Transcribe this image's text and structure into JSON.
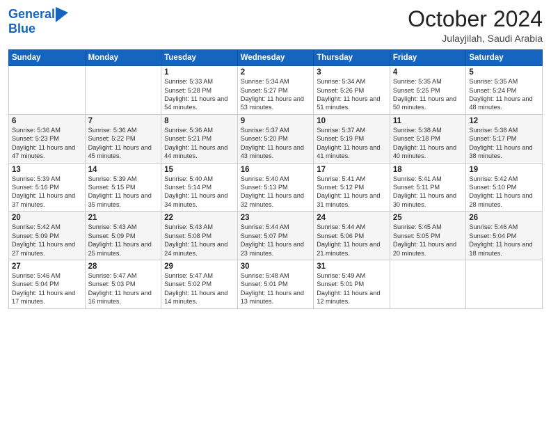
{
  "header": {
    "logo_line1": "General",
    "logo_line2": "Blue",
    "month": "October 2024",
    "location": "Julayjilah, Saudi Arabia"
  },
  "weekdays": [
    "Sunday",
    "Monday",
    "Tuesday",
    "Wednesday",
    "Thursday",
    "Friday",
    "Saturday"
  ],
  "weeks": [
    [
      {
        "day": "",
        "info": ""
      },
      {
        "day": "",
        "info": ""
      },
      {
        "day": "1",
        "info": "Sunrise: 5:33 AM\nSunset: 5:28 PM\nDaylight: 11 hours and 54 minutes."
      },
      {
        "day": "2",
        "info": "Sunrise: 5:34 AM\nSunset: 5:27 PM\nDaylight: 11 hours and 53 minutes."
      },
      {
        "day": "3",
        "info": "Sunrise: 5:34 AM\nSunset: 5:26 PM\nDaylight: 11 hours and 51 minutes."
      },
      {
        "day": "4",
        "info": "Sunrise: 5:35 AM\nSunset: 5:25 PM\nDaylight: 11 hours and 50 minutes."
      },
      {
        "day": "5",
        "info": "Sunrise: 5:35 AM\nSunset: 5:24 PM\nDaylight: 11 hours and 48 minutes."
      }
    ],
    [
      {
        "day": "6",
        "info": "Sunrise: 5:36 AM\nSunset: 5:23 PM\nDaylight: 11 hours and 47 minutes."
      },
      {
        "day": "7",
        "info": "Sunrise: 5:36 AM\nSunset: 5:22 PM\nDaylight: 11 hours and 45 minutes."
      },
      {
        "day": "8",
        "info": "Sunrise: 5:36 AM\nSunset: 5:21 PM\nDaylight: 11 hours and 44 minutes."
      },
      {
        "day": "9",
        "info": "Sunrise: 5:37 AM\nSunset: 5:20 PM\nDaylight: 11 hours and 43 minutes."
      },
      {
        "day": "10",
        "info": "Sunrise: 5:37 AM\nSunset: 5:19 PM\nDaylight: 11 hours and 41 minutes."
      },
      {
        "day": "11",
        "info": "Sunrise: 5:38 AM\nSunset: 5:18 PM\nDaylight: 11 hours and 40 minutes."
      },
      {
        "day": "12",
        "info": "Sunrise: 5:38 AM\nSunset: 5:17 PM\nDaylight: 11 hours and 38 minutes."
      }
    ],
    [
      {
        "day": "13",
        "info": "Sunrise: 5:39 AM\nSunset: 5:16 PM\nDaylight: 11 hours and 37 minutes."
      },
      {
        "day": "14",
        "info": "Sunrise: 5:39 AM\nSunset: 5:15 PM\nDaylight: 11 hours and 35 minutes."
      },
      {
        "day": "15",
        "info": "Sunrise: 5:40 AM\nSunset: 5:14 PM\nDaylight: 11 hours and 34 minutes."
      },
      {
        "day": "16",
        "info": "Sunrise: 5:40 AM\nSunset: 5:13 PM\nDaylight: 11 hours and 32 minutes."
      },
      {
        "day": "17",
        "info": "Sunrise: 5:41 AM\nSunset: 5:12 PM\nDaylight: 11 hours and 31 minutes."
      },
      {
        "day": "18",
        "info": "Sunrise: 5:41 AM\nSunset: 5:11 PM\nDaylight: 11 hours and 30 minutes."
      },
      {
        "day": "19",
        "info": "Sunrise: 5:42 AM\nSunset: 5:10 PM\nDaylight: 11 hours and 28 minutes."
      }
    ],
    [
      {
        "day": "20",
        "info": "Sunrise: 5:42 AM\nSunset: 5:09 PM\nDaylight: 11 hours and 27 minutes."
      },
      {
        "day": "21",
        "info": "Sunrise: 5:43 AM\nSunset: 5:09 PM\nDaylight: 11 hours and 25 minutes."
      },
      {
        "day": "22",
        "info": "Sunrise: 5:43 AM\nSunset: 5:08 PM\nDaylight: 11 hours and 24 minutes."
      },
      {
        "day": "23",
        "info": "Sunrise: 5:44 AM\nSunset: 5:07 PM\nDaylight: 11 hours and 23 minutes."
      },
      {
        "day": "24",
        "info": "Sunrise: 5:44 AM\nSunset: 5:06 PM\nDaylight: 11 hours and 21 minutes."
      },
      {
        "day": "25",
        "info": "Sunrise: 5:45 AM\nSunset: 5:05 PM\nDaylight: 11 hours and 20 minutes."
      },
      {
        "day": "26",
        "info": "Sunrise: 5:46 AM\nSunset: 5:04 PM\nDaylight: 11 hours and 18 minutes."
      }
    ],
    [
      {
        "day": "27",
        "info": "Sunrise: 5:46 AM\nSunset: 5:04 PM\nDaylight: 11 hours and 17 minutes."
      },
      {
        "day": "28",
        "info": "Sunrise: 5:47 AM\nSunset: 5:03 PM\nDaylight: 11 hours and 16 minutes."
      },
      {
        "day": "29",
        "info": "Sunrise: 5:47 AM\nSunset: 5:02 PM\nDaylight: 11 hours and 14 minutes."
      },
      {
        "day": "30",
        "info": "Sunrise: 5:48 AM\nSunset: 5:01 PM\nDaylight: 11 hours and 13 minutes."
      },
      {
        "day": "31",
        "info": "Sunrise: 5:49 AM\nSunset: 5:01 PM\nDaylight: 11 hours and 12 minutes."
      },
      {
        "day": "",
        "info": ""
      },
      {
        "day": "",
        "info": ""
      }
    ]
  ]
}
